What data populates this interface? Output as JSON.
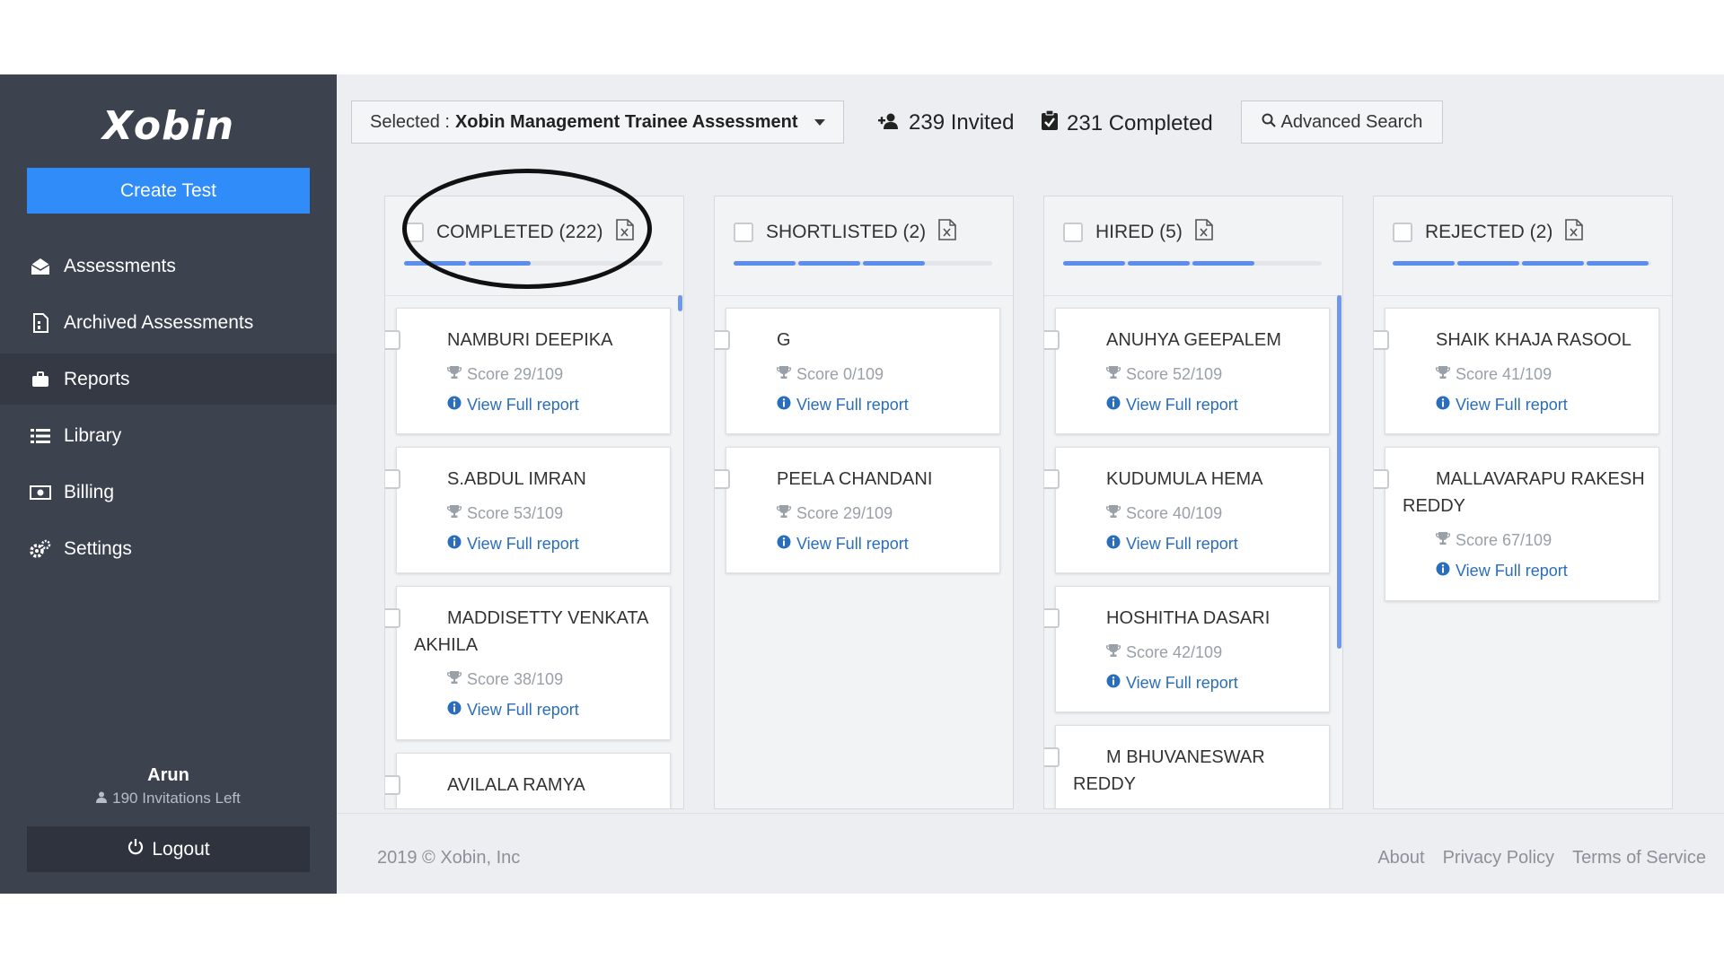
{
  "sidebar": {
    "logo": "Xobin",
    "create_label": "Create Test",
    "nav": [
      {
        "label": "Assessments",
        "icon": "envelope-open-icon"
      },
      {
        "label": "Archived Assessments",
        "icon": "archive-doc-icon"
      },
      {
        "label": "Reports",
        "icon": "briefcase-icon"
      },
      {
        "label": "Library",
        "icon": "list-icon"
      },
      {
        "label": "Billing",
        "icon": "money-icon"
      },
      {
        "label": "Settings",
        "icon": "gears-icon"
      }
    ],
    "active_item": "Reports",
    "user_name": "Arun",
    "invitations_left": "190 Invitations Left",
    "logout_label": "Logout"
  },
  "toolbar": {
    "selected_prefix": "Selected :",
    "selected_assessment": "Xobin Management Trainee Assessment",
    "invited": "239 Invited",
    "completed": "231 Completed",
    "advanced_search": "Advanced Search"
  },
  "columns": [
    {
      "title": "COMPLETED (222)",
      "cards": [
        {
          "name": "NAMBURI DEEPIKA",
          "score": "Score 29/109",
          "report": "View Full report"
        },
        {
          "name": "S.ABDUL IMRAN",
          "score": "Score 53/109",
          "report": "View Full report"
        },
        {
          "name": "MADDISETTY VENKATA AKHILA",
          "score": "Score 38/109",
          "report": "View Full report"
        },
        {
          "name": "AVILALA RAMYA",
          "score": "",
          "report": ""
        }
      ]
    },
    {
      "title": "SHORTLISTED (2)",
      "cards": [
        {
          "name": "G",
          "score": "Score 0/109",
          "report": "View Full report"
        },
        {
          "name": "PEELA CHANDANI",
          "score": "Score 29/109",
          "report": "View Full report"
        }
      ]
    },
    {
      "title": "HIRED (5)",
      "cards": [
        {
          "name": "ANUHYA GEEPALEM",
          "score": "Score 52/109",
          "report": "View Full report"
        },
        {
          "name": "KUDUMULA HEMA",
          "score": "Score 40/109",
          "report": "View Full report"
        },
        {
          "name": "HOSHITHA DASARI",
          "score": "Score 42/109",
          "report": "View Full report"
        },
        {
          "name": "M BHUVANESWAR REDDY",
          "score": "",
          "report": ""
        }
      ]
    },
    {
      "title": "REJECTED (2)",
      "cards": [
        {
          "name": "SHAIK KHAJA RASOOL",
          "score": "Score 41/109",
          "report": "View Full report"
        },
        {
          "name": "MALLAVARAPU RAKESH REDDY",
          "score": "Score 67/109",
          "report": "View Full report"
        }
      ]
    }
  ],
  "footer": {
    "copyright": "2019 © Xobin, Inc",
    "links": [
      "About",
      "Privacy Policy",
      "Terms of Service"
    ]
  },
  "colors": {
    "sidebar_bg": "#3d424f",
    "primary": "#2f8cf9",
    "link": "#2a6ebb",
    "progress": "#5b8def",
    "annotation": "#111111"
  }
}
